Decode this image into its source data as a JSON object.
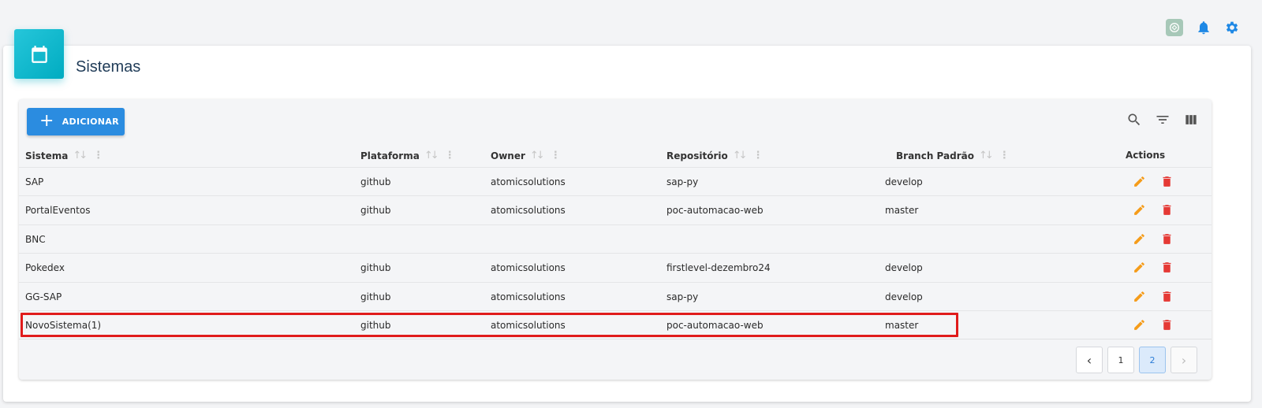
{
  "colors": {
    "accent": "#2b8ce0",
    "badge": "#00acc1",
    "edit": "#f59c1a",
    "delete": "#e53935",
    "highlight": "#e01b1b"
  },
  "topbar": {
    "icons": [
      "ai-assistant-icon",
      "bell-icon",
      "gear-icon"
    ]
  },
  "page": {
    "title": "Sistemas",
    "badge_icon": "calendar-icon"
  },
  "toolbar": {
    "add_label": "ADICIONAR",
    "icons": [
      "search-icon",
      "filter-icon",
      "columns-icon"
    ]
  },
  "table": {
    "columns": [
      "Sistema",
      "Plataforma",
      "Owner",
      "Repositório",
      "Branch Padrão",
      "Actions"
    ],
    "rows": [
      {
        "sistema": "SAP",
        "plataforma": "github",
        "owner": "atomicsolutions",
        "repositorio": "sap-py",
        "branch": "develop"
      },
      {
        "sistema": "PortalEventos",
        "plataforma": "github",
        "owner": "atomicsolutions",
        "repositorio": "poc-automacao-web",
        "branch": "master"
      },
      {
        "sistema": "BNC",
        "plataforma": "",
        "owner": "",
        "repositorio": "",
        "branch": ""
      },
      {
        "sistema": "Pokedex",
        "plataforma": "github",
        "owner": "atomicsolutions",
        "repositorio": "firstlevel-dezembro24",
        "branch": "develop"
      },
      {
        "sistema": "GG-SAP",
        "plataforma": "github",
        "owner": "atomicsolutions",
        "repositorio": "sap-py",
        "branch": "develop"
      },
      {
        "sistema": "NovoSistema(1)",
        "plataforma": "github",
        "owner": "atomicsolutions",
        "repositorio": "poc-automacao-web",
        "branch": "master"
      }
    ],
    "highlighted_row": 5
  },
  "pagination": {
    "prev": "‹",
    "pages": [
      "1",
      "2"
    ],
    "current": "2",
    "next": "›"
  }
}
